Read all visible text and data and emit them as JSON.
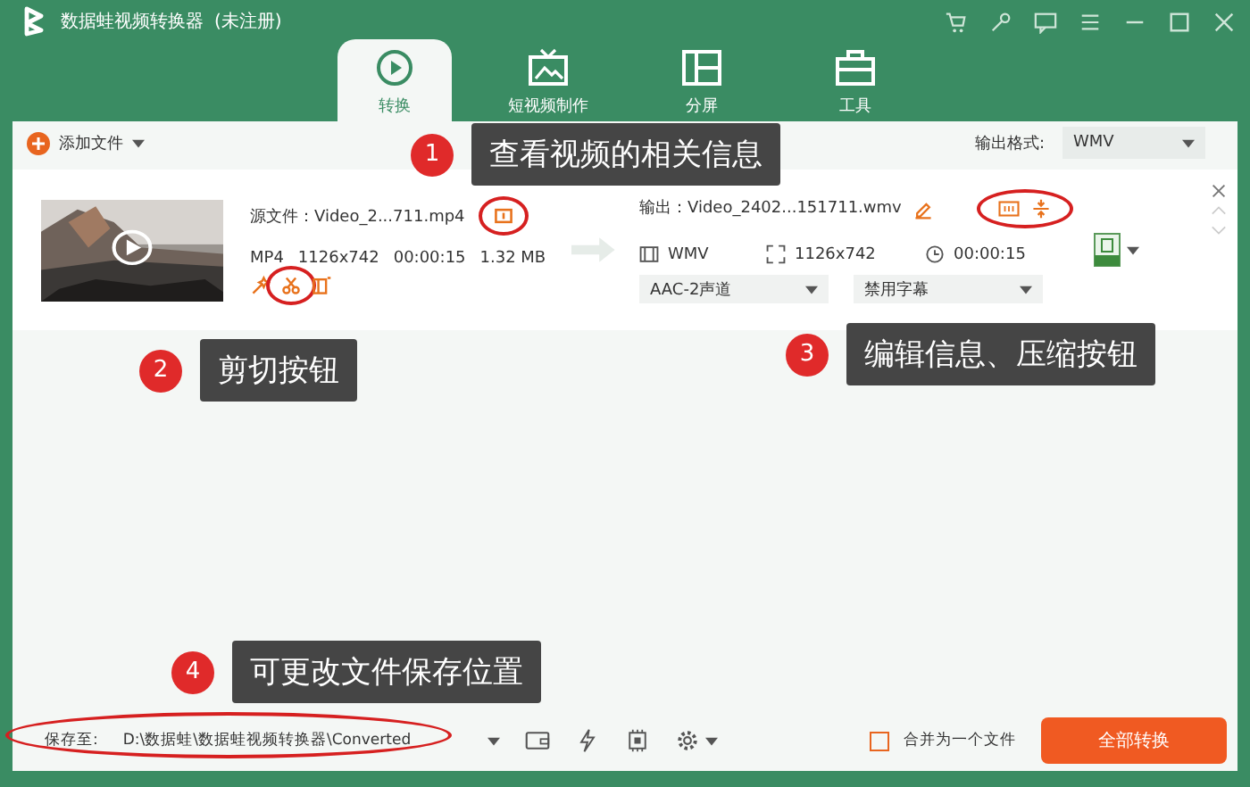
{
  "window": {
    "title": "数据蛙视频转换器",
    "status": "(未注册)"
  },
  "tabs": [
    {
      "label": "转换",
      "selected": true
    },
    {
      "label": "短视频制作",
      "selected": false
    },
    {
      "label": "分屏",
      "selected": false
    },
    {
      "label": "工具",
      "selected": false
    }
  ],
  "toolbar": {
    "add_button": "添加文件",
    "output_format_label": "输出格式:",
    "output_format": "WMV"
  },
  "file": {
    "source": "源文件：Video_2...711.mp4",
    "meta": [
      "MP4",
      "1126x742",
      "00:00:15",
      "1.32 MB"
    ],
    "output": "输出：Video_2402...151711.wmv",
    "format": "WMV",
    "resolution": "1126x742",
    "duration": "00:00:15",
    "audio": "AAC-2声道",
    "subtitle": "禁用字幕"
  },
  "callouts": [
    {
      "number": "1",
      "text": "查看视频的相关信息"
    },
    {
      "number": "2",
      "text": "剪切按钮"
    },
    {
      "number": "3",
      "text": "编辑信息、压缩按钮"
    },
    {
      "number": "4",
      "text": "可更改文件保存位置"
    }
  ],
  "bottom": {
    "save_label": "保存至:",
    "path": "D:\\数据蛙\\数据蛙视频转换器\\Converted",
    "merge_label": "合并为一个文件",
    "merge_checked": false,
    "convert_button": "全部转换"
  }
}
